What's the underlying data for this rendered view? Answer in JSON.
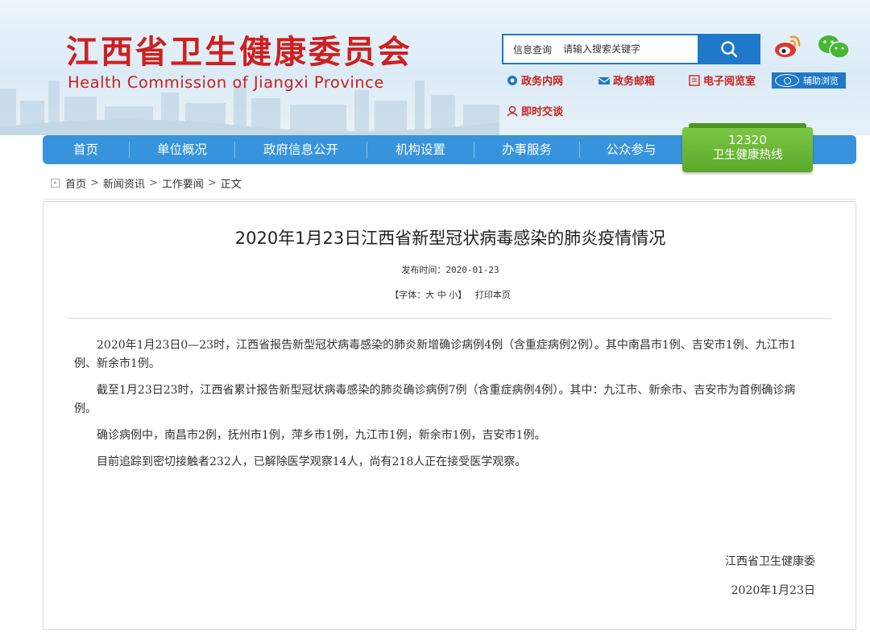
{
  "header": {
    "title_cn": "江西省卫生健康委员会",
    "title_en": "Health Commission of Jiangxi Province"
  },
  "search": {
    "label": "信息查询",
    "placeholder": "请输入搜索关键字"
  },
  "quick_links": [
    {
      "label": "政务内网",
      "icon": "gear-icon"
    },
    {
      "label": "政务邮箱",
      "icon": "mail-icon"
    },
    {
      "label": "电子阅览室",
      "icon": "book-icon"
    },
    {
      "label": "辅助浏览",
      "icon": "eye-icon"
    },
    {
      "label": "即时交谈",
      "icon": "chat-icon"
    }
  ],
  "nav": {
    "items": [
      "首页",
      "单位概况",
      "政府信息公开",
      "机构设置",
      "办事服务",
      "公众参与"
    ],
    "hotline_number": "12320",
    "hotline_label": "卫生健康热线"
  },
  "breadcrumb": [
    "首页",
    "新闻资讯",
    "工作要闻",
    "正文"
  ],
  "article": {
    "title": "2020年1月23日江西省新型冠状病毒感染的肺炎疫情情况",
    "publish_label": "发布时间：",
    "publish_date": "2020-01-23",
    "font_label": "【字体：",
    "font_large": "大",
    "font_medium": "中",
    "font_small": "小",
    "font_close": "】",
    "print_label": "打印本页",
    "paragraphs": [
      "2020年1月23日0—23时，江西省报告新型冠状病毒感染的肺炎新增确诊病例4例（含重症病例2例）。其中南昌市1例、吉安市1例、九江市1例、新余市1例。",
      "截至1月23日23时，江西省累计报告新型冠状病毒感染的肺炎确诊病例7例（含重症病例4例）。其中：九江市、新余市、吉安市为首例确诊病例。",
      "确诊病例中，南昌市2例，抚州市1例，萍乡市1例，九江市1例，新余市1例，吉安市1例。",
      "目前追踪到密切接触者232人，已解除医学观察14人，尚有218人正在接受医学观察。"
    ],
    "signature": "江西省卫生健康委",
    "signature_date": "2020年1月23日"
  },
  "colors": {
    "brand_red": "#cf1f1f",
    "nav_blue": "#3794dc",
    "search_blue": "#1f78c8",
    "hotline_green": "#6ab834"
  }
}
